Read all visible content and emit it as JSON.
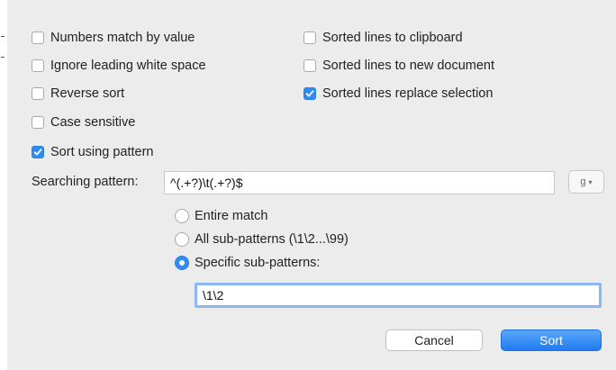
{
  "options_left": [
    {
      "label": "Numbers match by value",
      "checked": false
    },
    {
      "label": "Ignore leading white space",
      "checked": false
    },
    {
      "label": "Reverse sort",
      "checked": false
    },
    {
      "label": "Case sensitive",
      "checked": false
    },
    {
      "label": "Sort using pattern",
      "checked": true
    }
  ],
  "options_right": [
    {
      "label": "Sorted lines to clipboard",
      "checked": false
    },
    {
      "label": "Sorted lines to new document",
      "checked": false
    },
    {
      "label": "Sorted lines replace selection",
      "checked": true
    }
  ],
  "pattern": {
    "label": "Searching pattern:",
    "value": "^(.+?)\\t(.+?)$",
    "options_button": "g"
  },
  "match_modes": [
    {
      "label": "Entire match",
      "selected": false
    },
    {
      "label": "All sub-patterns (\\1\\2...\\99)",
      "selected": false
    },
    {
      "label": "Specific sub-patterns:",
      "selected": true
    }
  ],
  "sub_patterns_value": "\\1\\2",
  "buttons": {
    "cancel": "Cancel",
    "sort": "Sort"
  },
  "colors": {
    "accent": "#2f8cf5",
    "background": "#ececec"
  }
}
